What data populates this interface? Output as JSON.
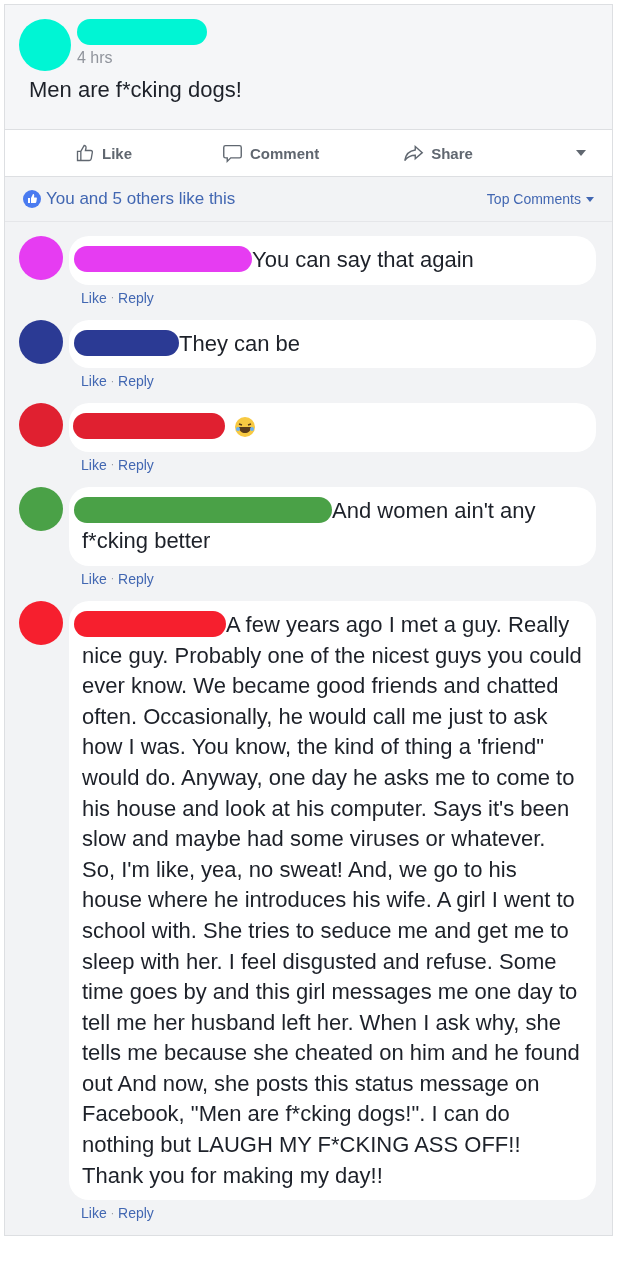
{
  "post": {
    "time": "4 hrs",
    "text": "Men are f*cking dogs!"
  },
  "actions": [
    {
      "kind": "like",
      "label": "Like"
    },
    {
      "kind": "comment",
      "label": "Comment"
    },
    {
      "kind": "share",
      "label": "Share"
    }
  ],
  "likes": {
    "summary": "You and 5 others like this",
    "sort": "Top Comments"
  },
  "separator": "·",
  "comments": [
    {
      "kind": "text",
      "color": "#e63cf2",
      "text": "You can say that again",
      "like": "Like",
      "reply": "Reply"
    },
    {
      "kind": "text",
      "color": "#2b3a94",
      "text": "They can be",
      "like": "Like",
      "reply": "Reply"
    },
    {
      "kind": "emoji",
      "color": "#e02030",
      "like": "Like",
      "reply": "Reply"
    },
    {
      "kind": "text",
      "color": "#4aa147",
      "text": "And women ain't any f*cking better",
      "like": "Like",
      "reply": "Reply"
    },
    {
      "kind": "text",
      "color": "#f61f2e",
      "text": "A few years ago I met a guy. Really nice guy. Probably one of the nicest guys you could ever know. We became good friends and chatted often. Occasionally, he would call me just to ask how I was. You know, the kind of thing a 'friend\" would do. Anyway, one day he asks me to come to his house and look at his computer. Says it's been slow and maybe had some viruses or whatever. So, I'm like, yea, no sweat! And, we go to his house where he introduces his wife. A girl I went to school with. She tries to seduce me and get me to sleep with her. I feel disgusted and refuse. Some time goes by and this girl messages me one day to tell me her husband left her. When I ask why, she tells me because she cheated on him and he found out And now, she posts this status message on Facebook, \"Men are f*cking dogs!\". I can do nothing but LAUGH MY F*CKING ASS OFF!! Thank you for making my day!!",
      "like": "Like",
      "reply": "Reply"
    }
  ]
}
